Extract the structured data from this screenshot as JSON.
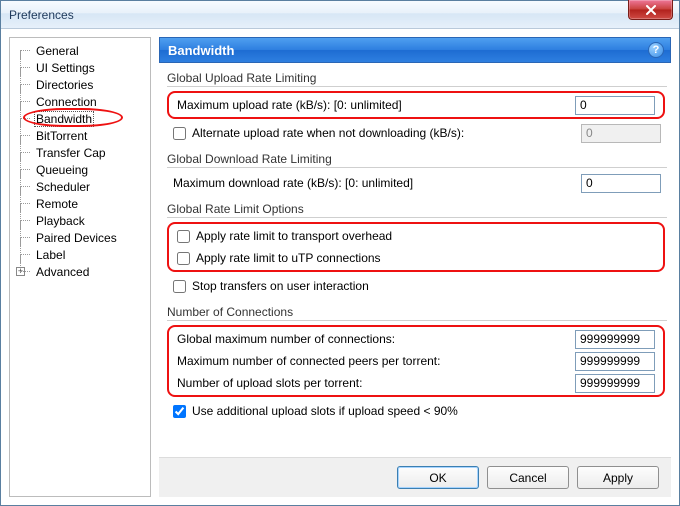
{
  "window": {
    "title": "Preferences"
  },
  "sidebar": {
    "items": [
      "General",
      "UI Settings",
      "Directories",
      "Connection",
      "Bandwidth",
      "BitTorrent",
      "Transfer Cap",
      "Queueing",
      "Scheduler",
      "Remote",
      "Playback",
      "Paired Devices",
      "Label",
      "Advanced"
    ],
    "selected": "Bandwidth"
  },
  "panel": {
    "title": "Bandwidth",
    "help": "?"
  },
  "upload_group": {
    "title": "Global Upload Rate Limiting",
    "max_label": "Maximum upload rate (kB/s): [0: unlimited]",
    "max_value": "0",
    "alt_label": "Alternate upload rate when not downloading (kB/s):",
    "alt_value": "0",
    "alt_checked": false
  },
  "download_group": {
    "title": "Global Download Rate Limiting",
    "max_label": "Maximum download rate (kB/s): [0: unlimited]",
    "max_value": "0"
  },
  "options_group": {
    "title": "Global Rate Limit Options",
    "overhead_label": "Apply rate limit to transport overhead",
    "overhead_checked": false,
    "utp_label": "Apply rate limit to uTP connections",
    "utp_checked": false,
    "stop_label": "Stop transfers on user interaction",
    "stop_checked": false
  },
  "conn_group": {
    "title": "Number of Connections",
    "global_label": "Global maximum number of connections:",
    "global_value": "999999999",
    "peers_label": "Maximum number of connected peers per torrent:",
    "peers_value": "999999999",
    "slots_label": "Number of upload slots per torrent:",
    "slots_value": "999999999",
    "extra_label": "Use additional upload slots if upload speed < 90%",
    "extra_checked": true
  },
  "buttons": {
    "ok": "OK",
    "cancel": "Cancel",
    "apply": "Apply"
  }
}
